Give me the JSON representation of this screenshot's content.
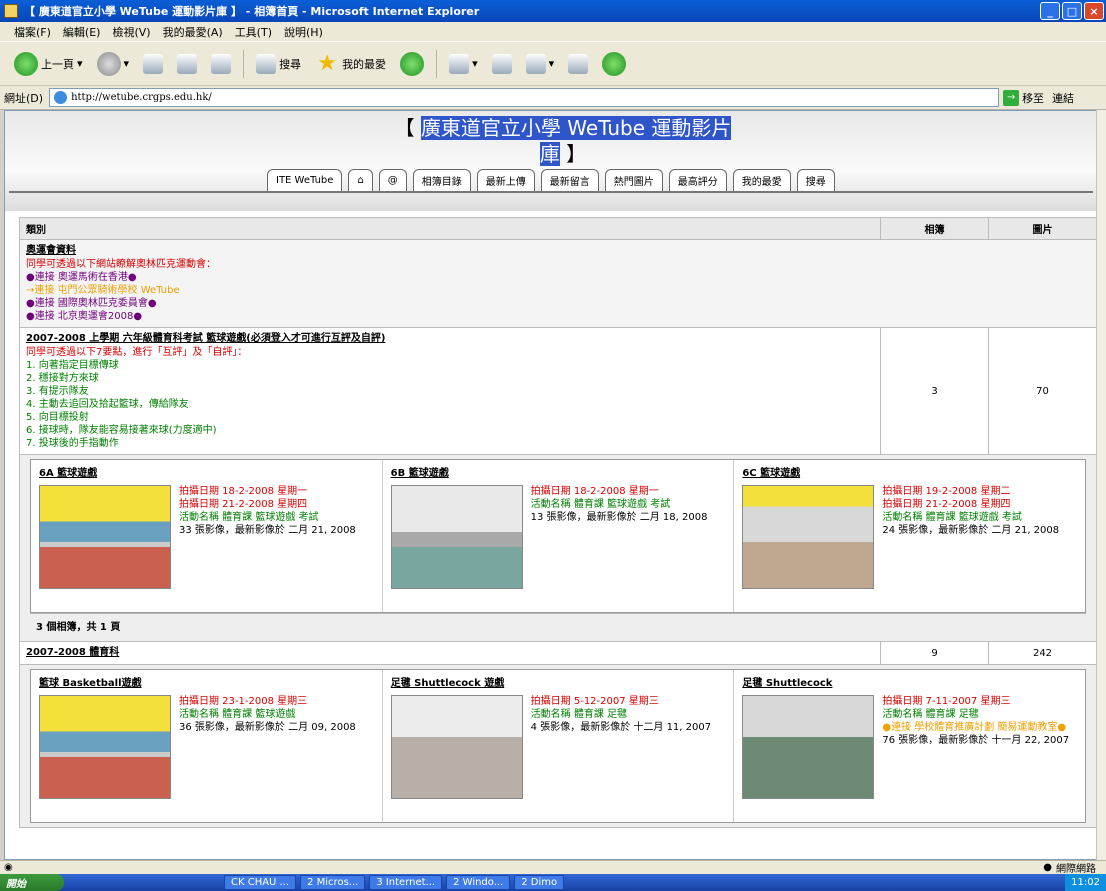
{
  "window": {
    "title": "【 廣東道官立小學 WeTube 運動影片庫 】 - 相簿首頁 - Microsoft Internet Explorer"
  },
  "menu": [
    "檔案(F)",
    "編輯(E)",
    "檢視(V)",
    "我的最愛(A)",
    "工具(T)",
    "說明(H)"
  ],
  "toolbar": {
    "back": "上一頁",
    "search": "搜尋",
    "favorites": "我的最愛"
  },
  "address": {
    "label": "網址(D)",
    "url": "http://wetube.crgps.edu.hk/",
    "go": "移至",
    "links": "連結"
  },
  "page": {
    "title_line1": "廣東道官立小學 WeTube 運動影片",
    "title_line2": "庫",
    "tabs": [
      "ITE WeTube",
      "⌂",
      "@",
      "相簿目錄",
      "最新上傳",
      "最新留言",
      "熱門圖片",
      "最高評分",
      "我的最愛",
      "搜尋"
    ]
  },
  "table": {
    "col_category": "類別",
    "col_albums": "相簿",
    "col_pictures": "圖片",
    "olympic": {
      "title": "奧運會資料",
      "intro": "同學可透過以下網站瞭解奧林匹克運動會：",
      "links": [
        "●連接 奧運馬術在香港●",
        "→連接 屯門公眾騎術學校 WeTube",
        "●連接 國際奧林匹克委員會●",
        "●連接 北京奧運會2008●"
      ]
    },
    "exam": {
      "title": "2007-2008 上學期 六年級體育科考試 籃球遊戲(必須登入才可進行互評及自評)",
      "intro": "同學可透過以下7要點，進行「互評」及「自評」：",
      "points": [
        "1. 向著指定目標傳球",
        "2. 穩接對方來球",
        "3. 有提示隊友",
        "4. 主動去追回及拾起籃球，傳給隊友",
        "5. 向目標投射",
        "6. 接球時，隊友能容易接著來球(力度適中)",
        "7. 投球後的手指動作"
      ],
      "albums": "3",
      "pictures": "70",
      "items": [
        {
          "name": "6A 籃球遊戲",
          "d1": "拍攝日期 18-2-2008 星期一",
          "d2": "拍攝日期 21-2-2008 星期四",
          "act": "活動名稱 體育課 籃球遊戲 考試",
          "count": "33 張影像，最新影像於 二月 21, 2008"
        },
        {
          "name": "6B 籃球遊戲",
          "d1": "拍攝日期 18-2-2008 星期一",
          "d2": "",
          "act": "活動名稱 體育課 籃球遊戲 考試",
          "count": "13 張影像，最新影像於 二月 18, 2008"
        },
        {
          "name": "6C 籃球遊戲",
          "d1": "拍攝日期 19-2-2008 星期二",
          "d2": "拍攝日期 21-2-2008 星期四",
          "act": "活動名稱 體育課 籃球遊戲 考試",
          "count": "24 張影像，最新影像於 二月 21, 2008"
        }
      ],
      "footer": "3 個相簿，共 1 頁"
    },
    "pe": {
      "title": "2007-2008 體育科",
      "albums": "9",
      "pictures": "242",
      "items": [
        {
          "name": "籃球 Basketball遊戲",
          "d1": "拍攝日期 23-1-2008 星期三",
          "act": "活動名稱 體育課 籃球遊戲",
          "extra": "",
          "count": "36 張影像，最新影像於 二月 09, 2008"
        },
        {
          "name": "足毽 Shuttlecock 遊戲",
          "d1": "拍攝日期 5-12-2007 星期三",
          "act": "活動名稱 體育課 足毽",
          "extra": "",
          "count": "4 張影像，最新影像於 十二月 11, 2007"
        },
        {
          "name": "足毽 Shuttlecock",
          "d1": "拍攝日期 7-11-2007 星期三",
          "act": "活動名稱 體育課 足毽",
          "extra": "●連接 學校體育推廣計劃 簡易運動教室●",
          "count": "76 張影像，最新影像於 十一月 22, 2007"
        }
      ]
    }
  },
  "status": {
    "zone": "網際網路"
  },
  "taskbar": {
    "start": "開始",
    "tasks": [
      "CK CHAU ...",
      "2 Micros...",
      "3 Internet...",
      "2 Windo...",
      "2 Dimo"
    ],
    "tray": "11:02"
  }
}
